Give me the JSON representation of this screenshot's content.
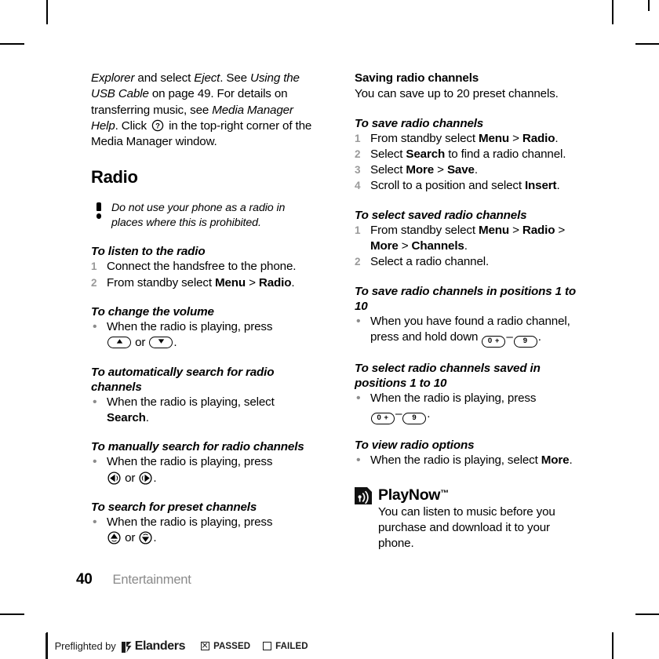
{
  "document": {
    "folio": "40",
    "running_head": "Entertainment"
  },
  "left_column": {
    "continued_paragraph": {
      "part1": "Explorer",
      "part2": " and select ",
      "part3": "Eject",
      "part4": ". See ",
      "part5": "Using the USB Cable",
      "part6": " on page 49. For details on transferring music, see ",
      "part7": "Media Manager Help",
      "part8": ". Click ",
      "help_icon": "help-question-icon",
      "part9": " in the top-right corner of the Media Manager window."
    },
    "radio_heading": "Radio",
    "warning_note": "Do not use your phone as a radio in places where this is prohibited.",
    "procedures": [
      {
        "heading": "To listen to the radio",
        "type": "ordered",
        "steps": [
          {
            "marker": "1",
            "text": "Connect the handsfree to the phone."
          },
          {
            "marker": "2",
            "prefix": "From standby select ",
            "bold1": "Menu",
            "sep": " > ",
            "bold2": "Radio",
            "suffix": "."
          }
        ]
      },
      {
        "heading": "To change the volume",
        "type": "bullet",
        "steps": [
          {
            "marker": "•",
            "text": "When the radio is playing, press",
            "keys": [
              "volume-up-key",
              "volume-down-key"
            ],
            "conjunction": "or",
            "trailing": "."
          }
        ]
      },
      {
        "heading": "To automatically search for radio channels",
        "type": "bullet",
        "steps": [
          {
            "marker": "•",
            "prefix": "When the radio is playing, select ",
            "bold1": "Search",
            "suffix": "."
          }
        ]
      },
      {
        "heading": "To manually search for radio channels",
        "type": "bullet",
        "steps": [
          {
            "marker": "•",
            "text": "When the radio is playing, press",
            "keys": [
              "nav-left-key",
              "nav-right-key"
            ],
            "conjunction": "or",
            "trailing": "."
          }
        ]
      },
      {
        "heading": "To search for preset channels",
        "type": "bullet",
        "steps": [
          {
            "marker": "•",
            "text": "When the radio is playing, press",
            "keys": [
              "nav-up-key",
              "nav-down-key"
            ],
            "conjunction": "or",
            "trailing": "."
          }
        ]
      }
    ]
  },
  "right_column": {
    "saving_heading": "Saving radio channels",
    "saving_intro": "You can save up to 20 preset channels.",
    "procedures": [
      {
        "heading": "To save radio channels",
        "type": "ordered",
        "steps": [
          {
            "marker": "1",
            "prefix": "From standby select ",
            "bold1": "Menu",
            "sep": " > ",
            "bold2": "Radio",
            "suffix": "."
          },
          {
            "marker": "2",
            "prefix": "Select ",
            "bold1": "Search",
            "suffix": " to find a radio channel."
          },
          {
            "marker": "3",
            "prefix": "Select ",
            "bold1": "More",
            "sep": " > ",
            "bold2": "Save",
            "suffix": "."
          },
          {
            "marker": "4",
            "prefix": "Scroll to a position and select ",
            "bold1": "Insert",
            "suffix": "."
          }
        ]
      },
      {
        "heading": "To select saved radio channels",
        "type": "ordered",
        "steps": [
          {
            "marker": "1",
            "prefix": "From standby select ",
            "bold1": "Menu",
            "sep": " > ",
            "bold2": "Radio",
            "sep2": " > ",
            "bold3": "More",
            "sep3": " > ",
            "bold4": "Channels",
            "suffix": "."
          },
          {
            "marker": "2",
            "text": "Select a radio channel."
          }
        ]
      },
      {
        "heading": "To save radio channels in positions 1 to 10",
        "type": "bullet",
        "steps": [
          {
            "marker": "•",
            "text": "When you have found a radio channel, press and hold down",
            "keys": [
              "key-0-plus",
              "key-9"
            ],
            "dash": "–",
            "trailing": "."
          }
        ]
      },
      {
        "heading": "To select radio channels saved in positions 1 to 10",
        "type": "bullet",
        "steps": [
          {
            "marker": "•",
            "text": "When the radio is playing, press",
            "keys": [
              "key-0-plus",
              "key-9"
            ],
            "dash": "–",
            "trailing": "."
          }
        ]
      },
      {
        "heading": "To view radio options",
        "type": "bullet",
        "steps": [
          {
            "marker": "•",
            "prefix": "When the radio is playing, select ",
            "bold1": "More",
            "suffix": "."
          }
        ]
      }
    ],
    "playnow": {
      "icon": "playnow-broadcast-icon",
      "heading": "PlayNow",
      "trademark": "™",
      "body": "You can listen to music before you purchase and download it to your phone."
    }
  },
  "keys": {
    "key_0_plus_label": "0 +",
    "key_9_label": "9"
  },
  "preflight": {
    "label": "Preflighted by",
    "brand": "Elanders",
    "passed": "PASSED",
    "failed": "FAILED",
    "passed_checked": true,
    "failed_checked": false
  },
  "colors": {
    "text": "#000000",
    "marker_gray": "#9a9a9a",
    "running_head_gray": "#8a8a8a",
    "preflight_ink": "#1b1b1b"
  }
}
